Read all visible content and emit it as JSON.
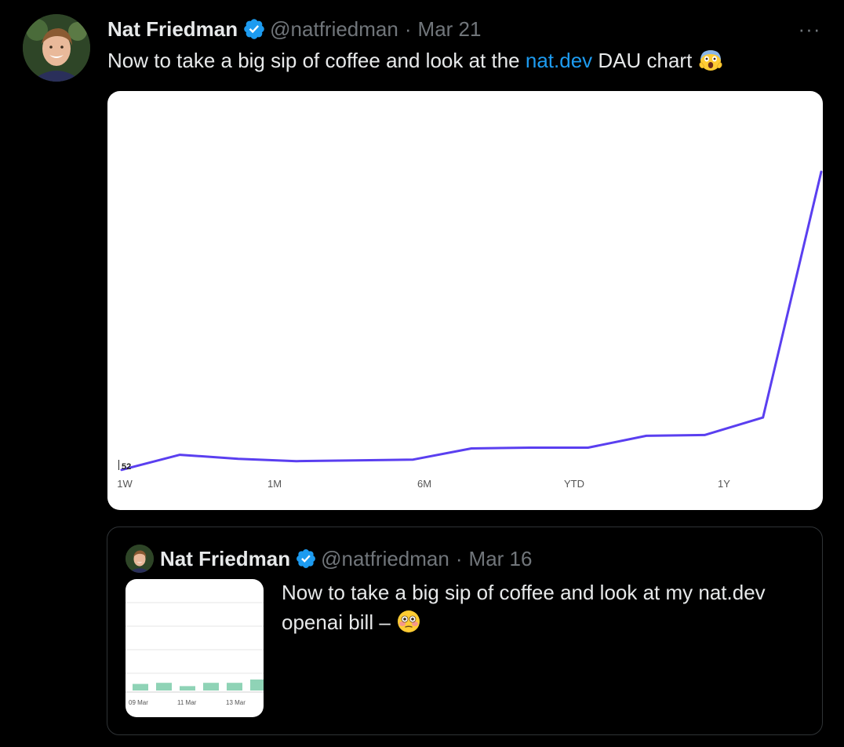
{
  "tweet": {
    "author_name": "Nat Friedman",
    "handle": "@natfriedman",
    "separator": "·",
    "date": "Mar 21",
    "more_label": "···",
    "text_before": "Now to take a big sip of coffee and look at the ",
    "link_text": "nat.dev",
    "text_after": " DAU chart ",
    "emoji": "face-screaming-in-fear"
  },
  "chart_data": {
    "type": "line",
    "series": [
      {
        "values": [
          52,
          71,
          66,
          63,
          64,
          65,
          79,
          80,
          80,
          95,
          96,
          118,
          428
        ]
      }
    ],
    "x_tick_labels": [
      "1W",
      "1M",
      "6M",
      "YTD",
      "1Y"
    ],
    "start_value_label": "52",
    "ylim": [
      35,
      510
    ],
    "line_color": "#5a3ff0",
    "grid": false
  },
  "quoted": {
    "author_name": "Nat Friedman",
    "handle": "@natfriedman",
    "separator": "·",
    "date": "Mar 16",
    "text": "Now to take a big sip of coffee and look at my nat.dev openai bill – ",
    "emoji": "flushed-face",
    "thumbnail": {
      "tick_labels": [
        "09 Mar",
        "11 Mar",
        "13 Mar"
      ],
      "bar_values": [
        6,
        7,
        4,
        7,
        7,
        10
      ],
      "bar_color": "#8fd3b6"
    }
  },
  "colors": {
    "background": "#000000",
    "text": "#e7e9ea",
    "secondary": "#71767b",
    "link": "#1d9bf0",
    "verified": "#1d9bf0"
  }
}
